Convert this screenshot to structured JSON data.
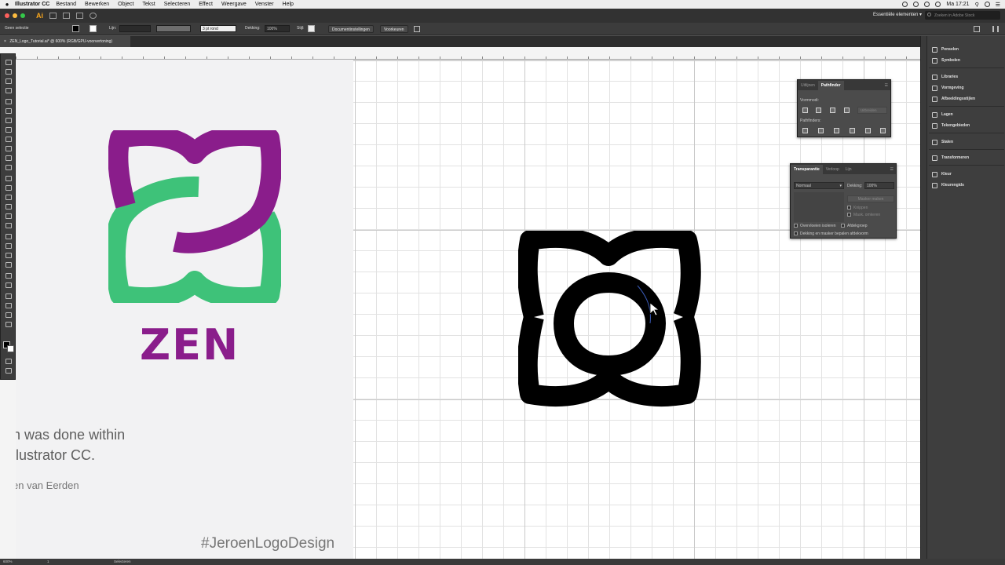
{
  "menubar": {
    "app_name": "Illustrator CC",
    "items": [
      "Bestand",
      "Bewerken",
      "Object",
      "Tekst",
      "Selecteren",
      "Effect",
      "Weergave",
      "Venster",
      "Help"
    ],
    "clock": "Ma 17:21"
  },
  "appbar": {
    "logo": "Ai",
    "workspace": "Essentiële elementen",
    "stock_placeholder": "Zoeken in Adobe Stock"
  },
  "controlbar": {
    "selection": "Geen selectie",
    "stroke_label": "Lijn:",
    "brush": "3 pt rond",
    "opacity_label": "Dekking:",
    "opacity_value": "100%",
    "style_label": "Stijl:",
    "doc_settings": "Documentinstellingen",
    "prefs": "Voorkeuren"
  },
  "doctab": {
    "title": "ZEN_Logo_Tutorial.ai* @ 600% (RGB/GPU-voorvertoning)"
  },
  "slide": {
    "brand": "ZEN",
    "line1": "n was done within",
    "line2": "llustrator CC.",
    "author": "en van Eerden",
    "hashtag": "#JeroenLogoDesign",
    "purple": "#8a1d8b",
    "green": "#3ec279"
  },
  "pathfinder": {
    "tabs": [
      "Uitlijnen",
      "Pathfinder"
    ],
    "shape_modes_label": "Vormmodi:",
    "expand": "Uitbreiden",
    "pathfinders_label": "Pathfinders:"
  },
  "transparency": {
    "tabs": [
      "Transparantie",
      "Verloop",
      "Lijn"
    ],
    "blend_mode": "Normaal",
    "opacity_label": "Dekking:",
    "opacity_value": "100%",
    "make_mask": "Masker maken",
    "clip": "Knippen",
    "invert": "Mask. omkeren",
    "isolate": "Overvloeien isoleren",
    "knockout": "Afdekgroep",
    "opacity_mask": "Dekking en masker bepalen afdekvorm"
  },
  "dock": {
    "items": [
      "Penselen",
      "Symbolen",
      "Libraries",
      "Vormgeving",
      "Afbeeldingsstijlen",
      "Lagen",
      "Tekengebieden",
      "Stalen",
      "Transformeren",
      "Kleur",
      "Kleurengids"
    ]
  },
  "statusbar": {
    "zoom": "600%",
    "artboard": "1",
    "tool": "Selecteren"
  }
}
